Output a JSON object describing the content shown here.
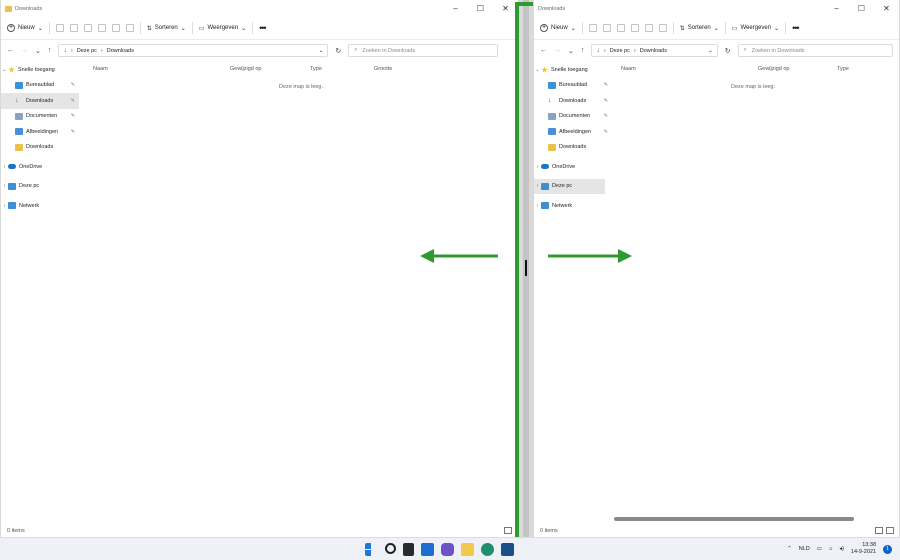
{
  "left_window": {
    "title": "Downloads",
    "toolbar": {
      "new_label": "Nieuw",
      "sort_label": "Sorteren",
      "view_label": "Weergeven",
      "more_label": "•••"
    },
    "breadcrumb": {
      "root": "Deze pc",
      "current": "Downloads"
    },
    "search_placeholder": "Zoeken in Downloads",
    "nav": {
      "quick_access": "Snelle toegang",
      "items": [
        "Bureaublad",
        "Downloads",
        "Documenten",
        "Afbeeldingen",
        "Downloads"
      ],
      "onedrive": "OneDrive",
      "this_pc": "Deze pc",
      "network": "Netwerk"
    },
    "columns": [
      "Naam",
      "Gewijzigd op",
      "Type",
      "Grootte"
    ],
    "empty_text": "Deze map is leeg.",
    "status_text": "0 items"
  },
  "right_window": {
    "title": "Downloads",
    "toolbar": {
      "new_label": "Nieuw",
      "sort_label": "Sorteren",
      "view_label": "Weergeven",
      "more_label": "•••"
    },
    "breadcrumb": {
      "root": "Deze pc",
      "current": "Downloads"
    },
    "search_placeholder": "Zoeken in Downloads",
    "nav": {
      "quick_access": "Snelle toegang",
      "items": [
        "Bureaublad",
        "Downloads",
        "Documenten",
        "Afbeeldingen",
        "Downloads"
      ],
      "onedrive": "OneDrive",
      "this_pc": "Deze pc",
      "network": "Netwerk"
    },
    "columns": [
      "Naam",
      "Gewijzigd op",
      "Type"
    ],
    "empty_text": "Deze map is leeg.",
    "status_text": "0 items"
  },
  "annotation_color": "#2f9a2f",
  "taskbar": {
    "language": "NLD",
    "time": "13:38",
    "date": "14-9-2021",
    "notification_count": "1"
  }
}
